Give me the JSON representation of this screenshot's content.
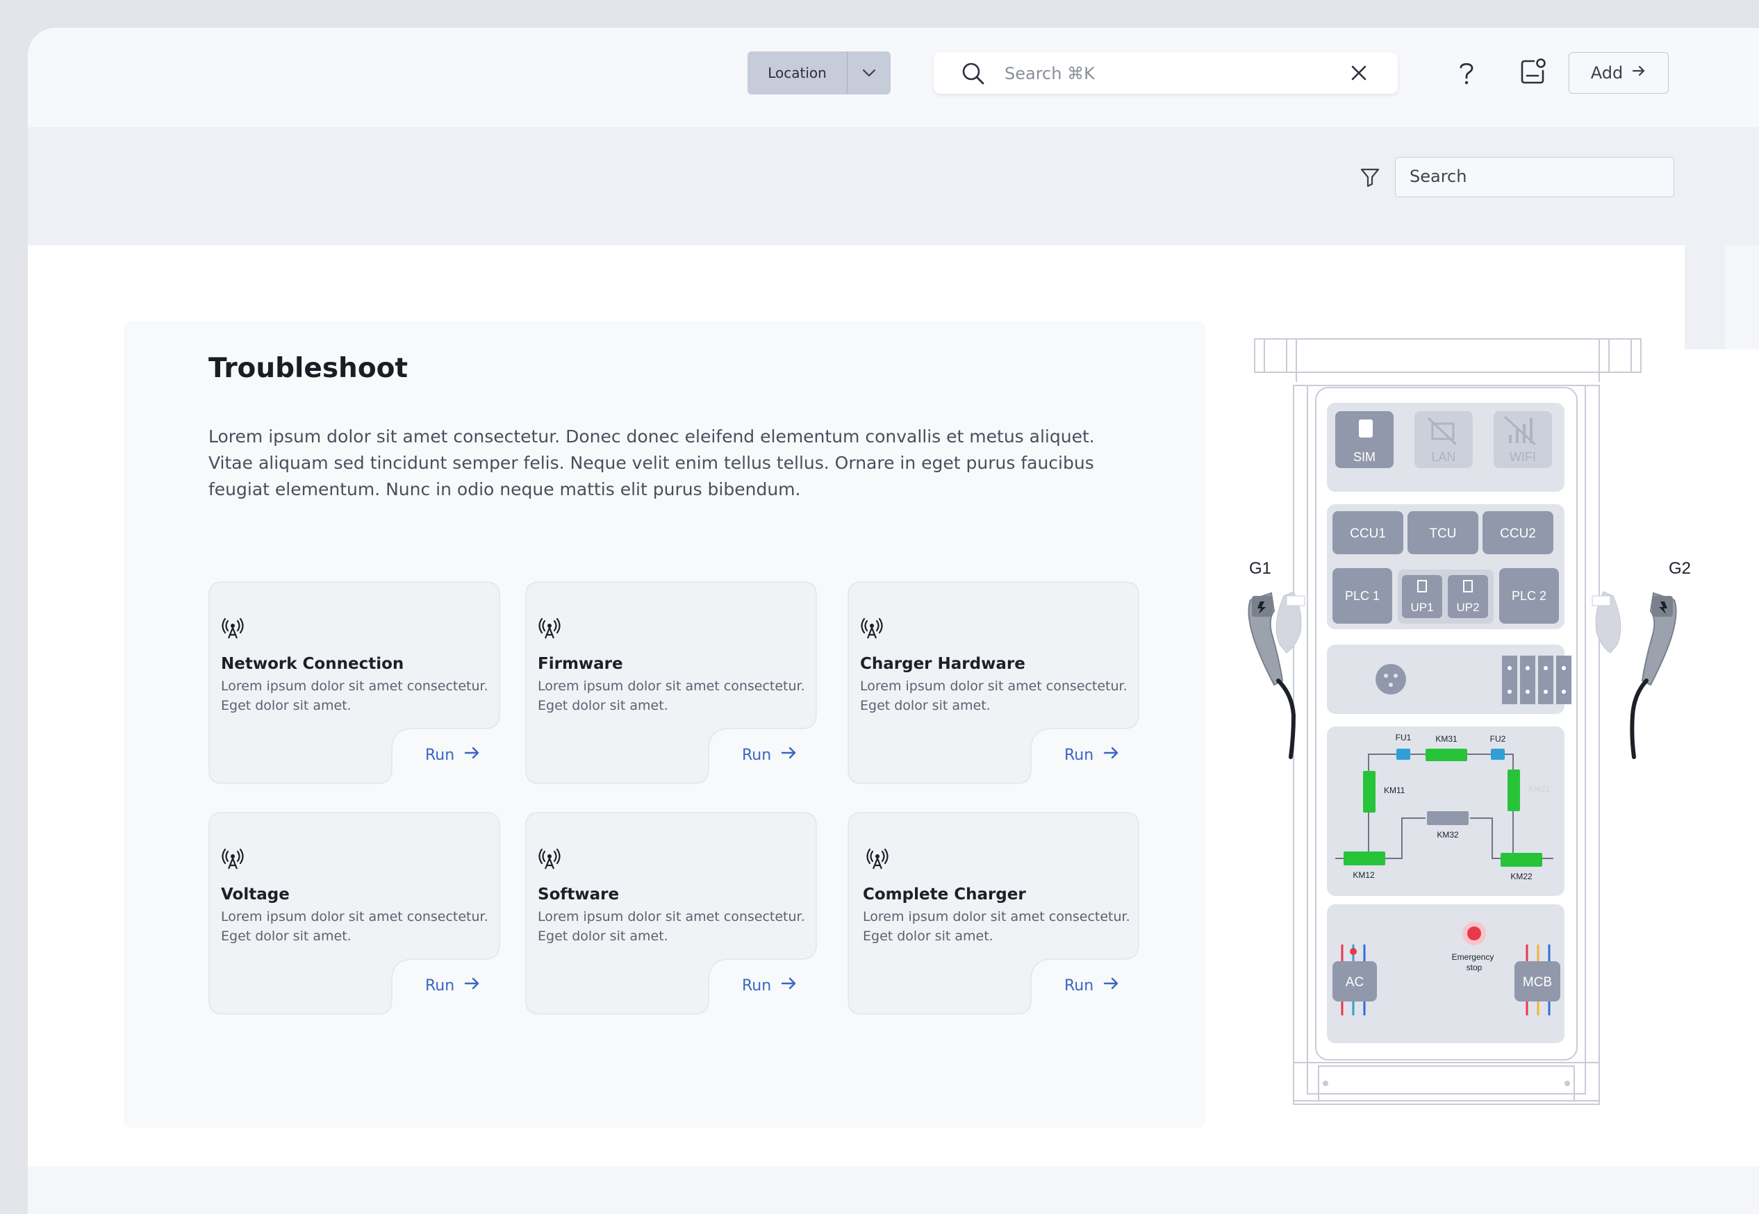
{
  "header": {
    "location_label": "Location",
    "search_placeholder": "Search ⌘K",
    "add_label": "Add"
  },
  "toolbar": {
    "search_placeholder": "Search"
  },
  "troubleshoot": {
    "title": "Troubleshoot",
    "description": "Lorem ipsum dolor sit amet consectetur. Donec donec eleifend elementum convallis et metus aliquet. Vitae aliquam sed tincidunt semper felis. Neque velit enim tellus tellus. Ornare in eget purus faucibus feugiat elementum. Nunc in odio neque mattis elit purus bibendum.",
    "cards": [
      {
        "title": "Network Connection",
        "desc": "Lorem ipsum dolor sit amet consectetur. Eget  dolor sit amet.",
        "action": "Run",
        "icon": "antenna-icon"
      },
      {
        "title": "Firmware",
        "desc": "Lorem ipsum dolor sit amet consectetur. Eget  dolor sit amet.",
        "action": "Run",
        "icon": "antenna-icon"
      },
      {
        "title": "Charger Hardware",
        "desc": "Lorem ipsum dolor sit amet consectetur. Eget  dolor sit amet.",
        "action": "Run",
        "icon": "antenna-icon"
      },
      {
        "title": "Voltage",
        "desc": "Lorem ipsum dolor sit amet consectetur. Eget  dolor sit amet.",
        "action": "Run",
        "icon": "antenna-icon"
      },
      {
        "title": "Software",
        "desc": "Lorem ipsum dolor sit amet consectetur. Eget  dolor sit amet.",
        "action": "Run",
        "icon": "antenna-icon"
      },
      {
        "title": "Complete Charger",
        "desc": "Lorem ipsum dolor sit amet consectetur. Eget  dolor sit amet.",
        "action": "Run",
        "icon": "antenna-icon"
      }
    ]
  },
  "charger": {
    "guns": {
      "left": "G1",
      "right": "G2"
    },
    "connectivity": {
      "sim": "SIM",
      "lan": "LAN",
      "wifi": "WIFI"
    },
    "controllers": {
      "ccu1": "CCU1",
      "tcu": "TCU",
      "ccu2": "CCU2",
      "plc1": "PLC 1",
      "up1": "UP1",
      "up2": "UP2",
      "plc2": "PLC 2"
    },
    "circuit": {
      "fu1": "FU1",
      "km31": "KM31",
      "fu2": "FU2",
      "km11": "KM11",
      "km21": "KM21",
      "km32": "KM32",
      "km12": "KM12",
      "km22": "KM22"
    },
    "bottom": {
      "ac": "AC",
      "emergency_line1": "Emergency",
      "emergency_line2": "stop",
      "mcb": "MCB"
    },
    "colors": {
      "contactor": "#27c43a",
      "fuse": "#2f9fd6",
      "emergency": "#e8394b",
      "module": "#9198ab",
      "panel": "#e0e3ea"
    }
  }
}
